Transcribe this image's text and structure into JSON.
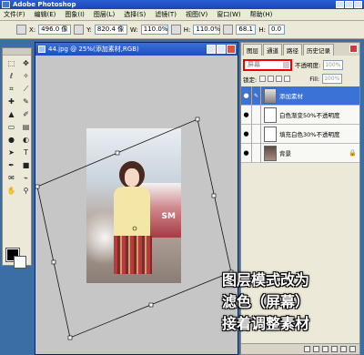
{
  "app": {
    "title": "Adobe Photoshop"
  },
  "menu": [
    "文件(F)",
    "编辑(E)",
    "图象(I)",
    "图层(L)",
    "选择(S)",
    "滤镜(T)",
    "视图(V)",
    "窗口(W)",
    "帮助(H)"
  ],
  "options": {
    "x_label": "X:",
    "x_value": "496.0 像",
    "y_label": "Y:",
    "y_value": "820.4 像",
    "w_label": "W:",
    "w_value": "110.0%",
    "h_label": "H:",
    "h_value": "110.0%",
    "angle_value": "68.1",
    "skew_h": "0.0",
    "skew_v": "0.0"
  },
  "document": {
    "title": "44.jpg @ 25%(添加素材,RGB)",
    "photo_text": "SM"
  },
  "layers_panel": {
    "tabs": [
      "图层",
      "通道",
      "路径",
      "历史记录"
    ],
    "blend_mode": "屏幕",
    "opacity_label": "不透明度:",
    "opacity_value": "100%",
    "lock_label": "锁定:",
    "fill_label": "Fill:",
    "fill_value": "100%",
    "layers": [
      {
        "name": "添加素材",
        "selected": true
      },
      {
        "name": "白色渐变50%不透明度",
        "selected": false
      },
      {
        "name": "填充白色30%不透明度",
        "selected": false
      },
      {
        "name": "背景",
        "selected": false
      }
    ]
  },
  "caption": [
    "图层模式改为",
    "滤色（屏幕）",
    "接着调整素材"
  ],
  "colors": {
    "accent": "#3b72d6",
    "highlight": "#ee0000",
    "title_bar": "#1a44b8"
  }
}
